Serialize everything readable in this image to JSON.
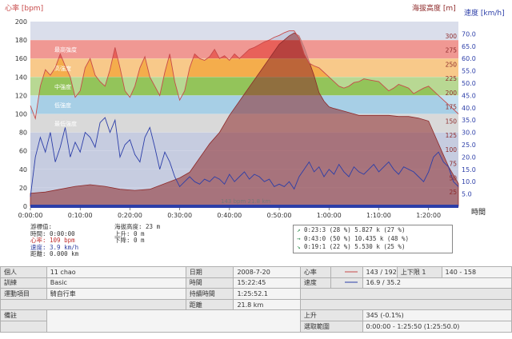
{
  "axes": {
    "hr_label": "心率 [bpm]",
    "alt_label": "海拔高度 [m]",
    "speed_label": "速度 [km/h]",
    "time_label": "時間",
    "hr_ticks": [
      "200",
      "180",
      "160",
      "140",
      "120",
      "100",
      "80",
      "60",
      "40",
      "20",
      "0"
    ],
    "alt_ticks": [
      "300",
      "275",
      "250",
      "225",
      "200",
      "175",
      "150",
      "125",
      "100",
      "75",
      "50",
      "25"
    ],
    "speed_ticks": [
      "70.0",
      "65.0",
      "60.0",
      "55.0",
      "50.0",
      "45.0",
      "40.0",
      "35.0",
      "30.0",
      "25.0",
      "20.0",
      "15.0",
      "10.0",
      "5.0"
    ],
    "time_ticks": [
      "0:00:00",
      "0:10:00",
      "0:20:00",
      "0:30:00",
      "0:40:00",
      "0:50:00",
      "1:00:00",
      "1:10:00",
      "1:20:00"
    ]
  },
  "zones": [
    {
      "label": "最高強度",
      "color": "#e8615a"
    },
    {
      "label": "高強度",
      "color": "#f4ad4c"
    },
    {
      "label": "中強度",
      "color": "#93c45a"
    },
    {
      "label": "低強度",
      "color": "#a7cfe6"
    },
    {
      "label": "最低強度",
      "color": "#d9d9d9"
    }
  ],
  "colors": {
    "hr_line": "#c84a4a",
    "speed_line": "#2c3ea8",
    "alt_fill": "#8e2a2a",
    "plot_bg": "#c6cce0"
  },
  "overlay_text": "143 bpm 21.8 km",
  "cursor": {
    "title": "游標值:",
    "time": "時間: 0:00:00",
    "hr": "心率: 109 bpm",
    "speed": "速度: 3.9 km/h",
    "distance": "距離: 0.000 km"
  },
  "altitude": {
    "value": "海拔高度: 23 m",
    "up": "上升: 0 m",
    "down": "下降: 0 m"
  },
  "zone_summary": [
    {
      "arrow": "↗",
      "text": "0:23:3  (28 %)  5.827 k  (27 %)"
    },
    {
      "arrow": "→",
      "text": "0:43:0  (50 %)  10.435 k  (48 %)"
    },
    {
      "arrow": "↘",
      "text": "0:19:1  (22 %)  5.530 k  (25 %)"
    }
  ],
  "info": {
    "r1": {
      "k1": "個人",
      "v1": "11 chao",
      "k2": "日期",
      "v2": "2008-7-20",
      "k3": "心率",
      "v3": "143 / 192",
      "k4": "上下限 1",
      "v4": "140 - 158"
    },
    "r2": {
      "k1": "訓練",
      "v1": "Basic",
      "k2": "時間",
      "v2": "15:22:45",
      "k3": "速度",
      "v3": "16.9 / 35.2"
    },
    "r3": {
      "k1": "運動項目",
      "v1": "騎自行車",
      "k2": "持續時間",
      "v2": "1:25:52.1"
    },
    "r4": {
      "k2": "距離",
      "v2": "21.8 km"
    },
    "r5": {
      "k1": "備註",
      "k3": "上升",
      "v3": "345 (-0.1%)"
    },
    "r6": {
      "k3": "選取範圍",
      "v3": "0:00:00 - 1:25:50 (1:25:50.0)"
    }
  },
  "chart_data": {
    "type": "line",
    "x_unit": "minutes",
    "xlim": [
      0,
      86
    ],
    "hr_ylim": [
      0,
      200
    ],
    "alt_ylim": [
      0,
      325
    ],
    "speed_ylim": [
      0,
      75
    ],
    "hr_zones": [
      [
        160,
        180
      ],
      [
        140,
        160
      ],
      [
        120,
        140
      ],
      [
        100,
        120
      ],
      [
        80,
        100
      ]
    ],
    "heart_rate": [
      [
        0,
        109
      ],
      [
        1,
        95
      ],
      [
        2,
        130
      ],
      [
        3,
        148
      ],
      [
        4,
        142
      ],
      [
        5,
        150
      ],
      [
        6,
        165
      ],
      [
        7,
        152
      ],
      [
        8,
        140
      ],
      [
        9,
        118
      ],
      [
        10,
        125
      ],
      [
        11,
        150
      ],
      [
        12,
        160
      ],
      [
        13,
        142
      ],
      [
        14,
        135
      ],
      [
        15,
        130
      ],
      [
        16,
        148
      ],
      [
        17,
        172
      ],
      [
        18,
        150
      ],
      [
        19,
        125
      ],
      [
        20,
        118
      ],
      [
        21,
        130
      ],
      [
        22,
        150
      ],
      [
        23,
        162
      ],
      [
        24,
        140
      ],
      [
        25,
        130
      ],
      [
        26,
        120
      ],
      [
        27,
        145
      ],
      [
        28,
        165
      ],
      [
        29,
        135
      ],
      [
        30,
        115
      ],
      [
        31,
        125
      ],
      [
        32,
        150
      ],
      [
        33,
        165
      ],
      [
        34,
        160
      ],
      [
        35,
        158
      ],
      [
        36,
        162
      ],
      [
        37,
        170
      ],
      [
        38,
        160
      ],
      [
        39,
        163
      ],
      [
        40,
        158
      ],
      [
        41,
        165
      ],
      [
        42,
        160
      ],
      [
        43,
        165
      ],
      [
        44,
        170
      ],
      [
        45,
        172
      ],
      [
        46,
        175
      ],
      [
        47,
        178
      ],
      [
        48,
        180
      ],
      [
        49,
        183
      ],
      [
        50,
        185
      ],
      [
        51,
        188
      ],
      [
        52,
        190
      ],
      [
        53,
        190
      ],
      [
        54,
        182
      ],
      [
        55,
        165
      ],
      [
        56,
        155
      ],
      [
        57,
        152
      ],
      [
        58,
        150
      ],
      [
        59,
        145
      ],
      [
        60,
        140
      ],
      [
        61,
        135
      ],
      [
        62,
        130
      ],
      [
        63,
        128
      ],
      [
        64,
        130
      ],
      [
        65,
        134
      ],
      [
        66,
        135
      ],
      [
        67,
        138
      ],
      [
        68,
        137
      ],
      [
        69,
        136
      ],
      [
        70,
        135
      ],
      [
        71,
        130
      ],
      [
        72,
        125
      ],
      [
        73,
        128
      ],
      [
        74,
        132
      ],
      [
        75,
        130
      ],
      [
        76,
        128
      ],
      [
        77,
        122
      ],
      [
        78,
        125
      ],
      [
        79,
        128
      ],
      [
        80,
        130
      ],
      [
        81,
        125
      ],
      [
        82,
        120
      ],
      [
        83,
        115
      ],
      [
        84,
        110
      ],
      [
        85,
        105
      ],
      [
        86,
        100
      ]
    ],
    "speed": [
      [
        0,
        3.9
      ],
      [
        1,
        20
      ],
      [
        2,
        28
      ],
      [
        3,
        22
      ],
      [
        4,
        30
      ],
      [
        5,
        18
      ],
      [
        6,
        24
      ],
      [
        7,
        32
      ],
      [
        8,
        20
      ],
      [
        9,
        26
      ],
      [
        10,
        22
      ],
      [
        11,
        30
      ],
      [
        12,
        28
      ],
      [
        13,
        24
      ],
      [
        14,
        34
      ],
      [
        15,
        36
      ],
      [
        16,
        30
      ],
      [
        17,
        35
      ],
      [
        18,
        20
      ],
      [
        19,
        25
      ],
      [
        20,
        27
      ],
      [
        21,
        21
      ],
      [
        22,
        18
      ],
      [
        23,
        28
      ],
      [
        24,
        32
      ],
      [
        25,
        24
      ],
      [
        26,
        15
      ],
      [
        27,
        22
      ],
      [
        28,
        18
      ],
      [
        29,
        12
      ],
      [
        30,
        8
      ],
      [
        31,
        10
      ],
      [
        32,
        12
      ],
      [
        33,
        10
      ],
      [
        34,
        9
      ],
      [
        35,
        11
      ],
      [
        36,
        10
      ],
      [
        37,
        12
      ],
      [
        38,
        11
      ],
      [
        39,
        9
      ],
      [
        40,
        13
      ],
      [
        41,
        10
      ],
      [
        42,
        12
      ],
      [
        43,
        14
      ],
      [
        44,
        11
      ],
      [
        45,
        13
      ],
      [
        46,
        12
      ],
      [
        47,
        10
      ],
      [
        48,
        11
      ],
      [
        49,
        8
      ],
      [
        50,
        9
      ],
      [
        51,
        8
      ],
      [
        52,
        10
      ],
      [
        53,
        7
      ],
      [
        54,
        12
      ],
      [
        55,
        15
      ],
      [
        56,
        18
      ],
      [
        57,
        14
      ],
      [
        58,
        16
      ],
      [
        59,
        12
      ],
      [
        60,
        15
      ],
      [
        61,
        13
      ],
      [
        62,
        17
      ],
      [
        63,
        14
      ],
      [
        64,
        12
      ],
      [
        65,
        16
      ],
      [
        66,
        14
      ],
      [
        67,
        13
      ],
      [
        68,
        15
      ],
      [
        69,
        17
      ],
      [
        70,
        14
      ],
      [
        71,
        16
      ],
      [
        72,
        18
      ],
      [
        73,
        15
      ],
      [
        74,
        13
      ],
      [
        75,
        16
      ],
      [
        76,
        15
      ],
      [
        77,
        14
      ],
      [
        78,
        12
      ],
      [
        79,
        10
      ],
      [
        80,
        14
      ],
      [
        81,
        20
      ],
      [
        82,
        22
      ],
      [
        83,
        18
      ],
      [
        84,
        16
      ],
      [
        85,
        10
      ],
      [
        86,
        8
      ]
    ],
    "altitude": [
      [
        0,
        23
      ],
      [
        3,
        25
      ],
      [
        6,
        30
      ],
      [
        9,
        35
      ],
      [
        12,
        38
      ],
      [
        15,
        35
      ],
      [
        18,
        30
      ],
      [
        21,
        28
      ],
      [
        24,
        30
      ],
      [
        27,
        40
      ],
      [
        30,
        50
      ],
      [
        32,
        60
      ],
      [
        34,
        85
      ],
      [
        36,
        110
      ],
      [
        38,
        130
      ],
      [
        40,
        160
      ],
      [
        42,
        185
      ],
      [
        44,
        210
      ],
      [
        46,
        235
      ],
      [
        48,
        260
      ],
      [
        50,
        285
      ],
      [
        52,
        300
      ],
      [
        53,
        305
      ],
      [
        54,
        300
      ],
      [
        55,
        280
      ],
      [
        56,
        255
      ],
      [
        57,
        230
      ],
      [
        58,
        200
      ],
      [
        59,
        185
      ],
      [
        60,
        175
      ],
      [
        61,
        172
      ],
      [
        62,
        170
      ],
      [
        64,
        165
      ],
      [
        66,
        160
      ],
      [
        68,
        160
      ],
      [
        70,
        160
      ],
      [
        72,
        160
      ],
      [
        74,
        158
      ],
      [
        76,
        158
      ],
      [
        78,
        155
      ],
      [
        80,
        150
      ],
      [
        82,
        110
      ],
      [
        84,
        70
      ],
      [
        86,
        40
      ]
    ]
  }
}
